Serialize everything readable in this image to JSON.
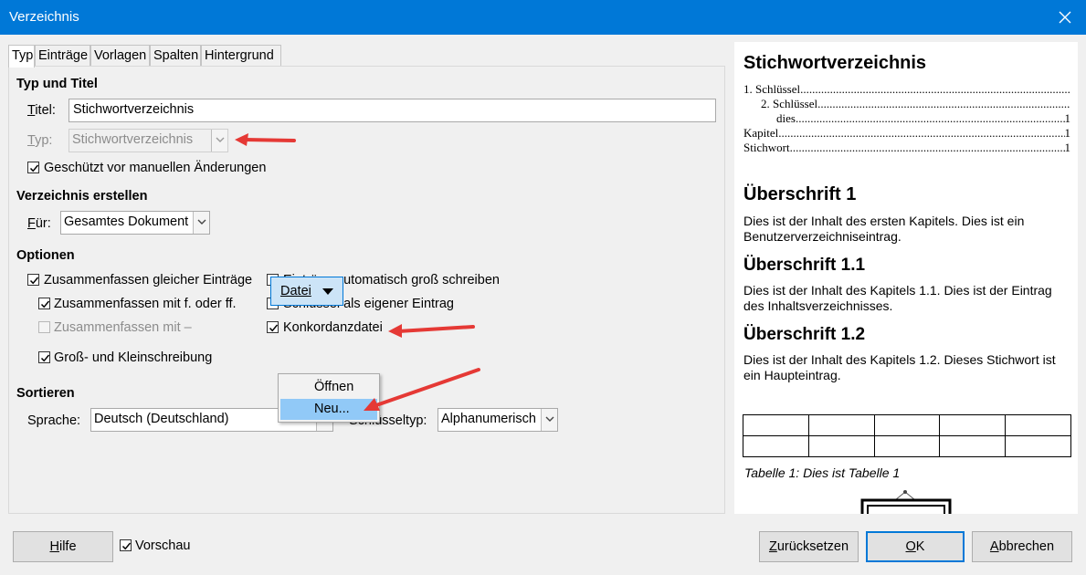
{
  "window": {
    "title": "Verzeichnis"
  },
  "tabs": [
    {
      "label": "Typ",
      "active": true
    },
    {
      "label": "Einträge"
    },
    {
      "label": "Vorlagen"
    },
    {
      "label": "Spalten"
    },
    {
      "label": "Hintergrund"
    }
  ],
  "type_title": {
    "heading": "Typ und Titel",
    "title_label": "Titel:",
    "title_value": "Stichwortverzeichnis",
    "type_label": "Typ:",
    "type_value": "Stichwortverzeichnis",
    "protected_label": "Geschützt vor manuellen Änderungen",
    "protected_checked": true
  },
  "create_index": {
    "heading": "Verzeichnis erstellen",
    "for_label": "Für:",
    "for_value": "Gesamtes Dokument"
  },
  "options": {
    "heading": "Optionen",
    "combine_identical": {
      "label": "Zusammenfassen gleicher Einträge",
      "checked": true
    },
    "combine_ff": {
      "label": "Zusammenfassen mit f. oder ff.",
      "checked": true
    },
    "combine_dash": {
      "label": "Zusammenfassen mit –",
      "checked": false,
      "disabled": true
    },
    "case_sensitive": {
      "label": "Groß- und Kleinschreibung",
      "checked": true
    },
    "auto_capitalize": {
      "label": "Einträge automatisch groß schreiben",
      "checked": false
    },
    "keys_separate": {
      "label": "Schlüssel als eigener Eintrag",
      "checked": false
    },
    "concordance": {
      "label": "Konkordanzdatei",
      "checked": true
    },
    "file_button": "Datei",
    "file_menu": [
      "Öffnen",
      "Neu..."
    ],
    "file_menu_highlighted": "Neu..."
  },
  "sort": {
    "heading": "Sortieren",
    "language_label": "Sprache:",
    "language_value": "Deutsch (Deutschland)",
    "keytype_label": "Schlüsseltyp:",
    "keytype_value": "Alphanumerisch"
  },
  "preview": {
    "index_title": "Stichwortverzeichnis",
    "toc": [
      {
        "text": "1. Schlüssel",
        "page": ""
      },
      {
        "text": "2. Schlüssel",
        "page": ""
      },
      {
        "text": "dies",
        "page": "1"
      },
      {
        "text": "Kapitel",
        "page": "1"
      },
      {
        "text": "Stichwort",
        "page": "1"
      }
    ],
    "h1": "Überschrift 1",
    "p1": "Dies ist der Inhalt des ersten Kapitels. Dies ist ein Benutzerverzeichniseintrag.",
    "h11": "Überschrift 1.1",
    "p11": "Dies ist der Inhalt des Kapitels 1.1. Dies ist der Eintrag des Inhaltsverzeichnisses.",
    "h12": "Überschrift 1.2",
    "p12": "Dies ist der Inhalt des Kapitels 1.2. Dieses Stichwort ist ein Haupteintrag.",
    "table_caption": "Tabelle 1: Dies ist Tabelle 1"
  },
  "footer": {
    "help": "Hilfe",
    "preview_label": "Vorschau",
    "preview_checked": true,
    "reset": "Zurücksetzen",
    "ok": "OK",
    "cancel": "Abbrechen"
  },
  "colors": {
    "titlebar": "#0078d7",
    "annotation_arrow": "#e53935",
    "menu_highlight": "#91c9f7"
  }
}
